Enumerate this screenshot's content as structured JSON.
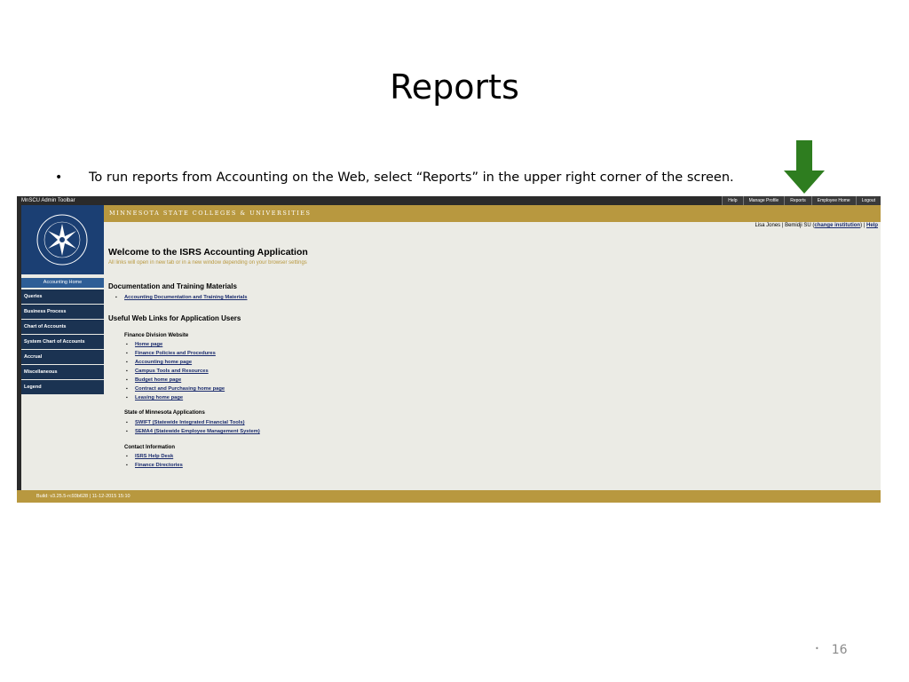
{
  "slide": {
    "title": "Reports",
    "bullet": "To run reports from Accounting on the Web, select “Reports” in the upper right corner of the screen.",
    "page_number": "16"
  },
  "app": {
    "admin_toolbar_label": "MnSCU Admin Toolbar",
    "admin_links": [
      "Help",
      "Manage Profile",
      "Reports",
      "Employee Home",
      "Logout"
    ],
    "brand_text": "MINNESOTA STATE COLLEGES & UNIVERSITIES",
    "user_line": {
      "name": "Lisa Jones | Bemidji SU (",
      "change_link": "change institution",
      "sep": ") | ",
      "help_link": "Help"
    },
    "sidebar": {
      "active": "Accounting Home",
      "items": [
        "Queries",
        "Business Process",
        "Chart of Accounts",
        "System Chart of Accounts",
        "Accrual",
        "Miscellaneous",
        "Legend"
      ]
    },
    "main": {
      "welcome": "Welcome to the ISRS Accounting Application",
      "notice": "All links will open in new tab or in a new window depending on your browser settings",
      "doc_title": "Documentation and Training Materials",
      "doc_link": "Accounting Documentation and Training Materials",
      "web_links_title": "Useful Web Links for Application Users",
      "finance_title": "Finance Division Website",
      "finance_links": [
        "Home page",
        "Finance Policies and Procedures",
        "Accounting home page",
        "Campus Tools and Resources",
        "Budget home page",
        "Contract and Purchasing home page",
        "Leasing home page"
      ],
      "state_title": "State of Minnesota Applications",
      "state_links": [
        "SWIFT (Statewide Integrated Financial Tools)",
        "SEMA4 (Statewide Employee Management System)"
      ],
      "contact_title": "Contact Information",
      "contact_links": [
        "ISRS Help Desk",
        "Finance Directories"
      ]
    },
    "footer": "Build: v3.25.5-rc93b628 | 11-12-2015 15:10"
  },
  "colors": {
    "gold": "#b8983f",
    "navy": "#1b3352",
    "arrow": "#2e7d1f"
  }
}
